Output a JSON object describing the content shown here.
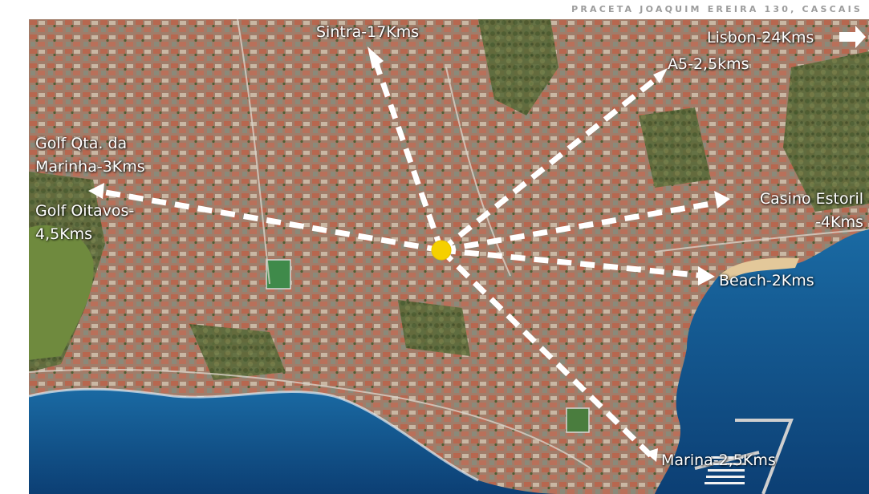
{
  "header": {
    "address": "PRACETA JOAQUIM EREIRA 130, CASCAIS"
  },
  "destinations": {
    "sintra": "Sintra-17Kms",
    "lisbon": "Lisbon-24Kms",
    "a5": "A5-2,5kms",
    "golf_marinha": "Golf Qta. da Marinha-3Kms",
    "golf_oitavos": "Golf Oitavos-4,5Kms",
    "casino": "Casino Estoril -4Kms",
    "beach": "Beach-2Kms",
    "marina": "Marina-2,5Kms"
  },
  "marker": {
    "name": "property-location-marker",
    "color": "#f5d000"
  },
  "colors": {
    "sea": "#0f4f8a",
    "urban": "#a47e6b",
    "vegetation": "#5c6b3c",
    "arrow": "#ffffff"
  }
}
